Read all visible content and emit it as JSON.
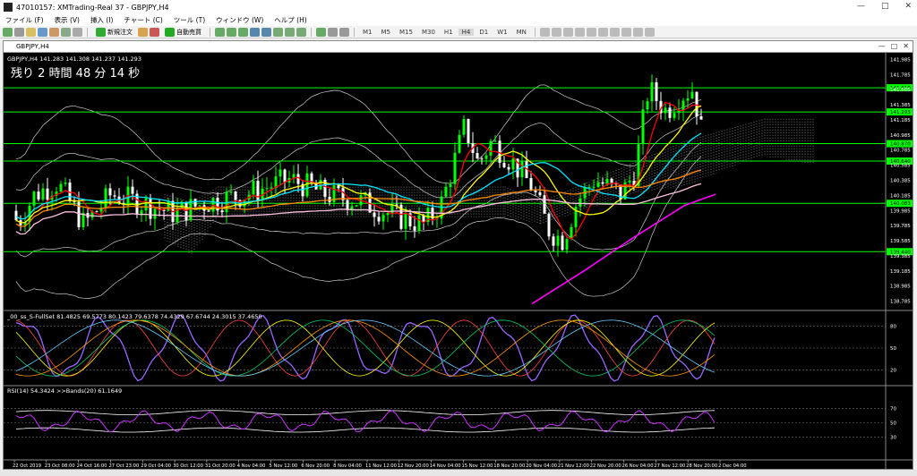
{
  "window": {
    "title": "47010157: XMTrading-Real 37 - GBPJPY,H4"
  },
  "menu": [
    "ファイル (F)",
    "表示 (V)",
    "挿入 (I)",
    "チャート (C)",
    "ツール (T)",
    "ウィンドウ (W)",
    "ヘルプ (H)"
  ],
  "toolbar": {
    "new_order": "新規注文",
    "auto_trade": "自動売買",
    "timeframes": [
      "M1",
      "M5",
      "M15",
      "M30",
      "H1",
      "H4",
      "D1",
      "W1",
      "MN"
    ],
    "active_timeframe": "H4"
  },
  "chart_window": {
    "title": "GBPJPY,H4"
  },
  "main_chart": {
    "info": "GBPJPY,H4  141.283 141.308 141.237 141.293",
    "countdown": "残り 2 時間 48 分 14 秒",
    "price_labels": [
      "141.985",
      "141.785",
      "141.585",
      "141.385",
      "141.185",
      "140.985",
      "140.785",
      "140.585",
      "140.385",
      "140.185",
      "139.985",
      "139.785",
      "139.585",
      "139.385",
      "139.185",
      "138.985",
      "138.785"
    ],
    "hlines": [
      {
        "price": 141.61,
        "label": "141.610"
      },
      {
        "price": 141.29,
        "label": "141.293"
      },
      {
        "price": 140.87,
        "label": "140.870"
      },
      {
        "price": 140.64,
        "label": "140.640"
      },
      {
        "price": 140.08,
        "label": "140.083"
      },
      {
        "price": 139.44,
        "label": "139.440"
      }
    ]
  },
  "indicator1": {
    "info": "_00_ss_S-FullSet 81.4825 69.5773 80.1423 79.6378 74.4329 67.6744 24.3015 37.4650",
    "levels": [
      "80",
      "50",
      "20"
    ]
  },
  "indicator2": {
    "info": "RSI(14) 54.3424  >>Bands(20) 61.1649",
    "levels": [
      "70",
      "50",
      "30"
    ]
  },
  "time_axis": [
    "22 Oct 2019",
    "23 Oct 08:00",
    "24 Oct 16:00",
    "27 Oct 23:00",
    "29 Oct 04:00",
    "30 Oct 12:00",
    "31 Oct 20:00",
    "4 Nov 04:00",
    "5 Nov 12:00",
    "6 Nov 20:00",
    "8 Nov 04:00",
    "11 Nov 12:00",
    "12 Nov 20:00",
    "14 Nov 04:00",
    "15 Nov 12:00",
    "18 Nov 20:00",
    "20 Nov 04:00",
    "21 Nov 12:00",
    "22 Nov 20:00",
    "26 Nov 04:00",
    "27 Nov 12:00",
    "28 Nov 20:00",
    "2 Dec 04:00"
  ],
  "colors": {
    "background": "#000000",
    "bull": "#00ff00",
    "bear": "#ffffff",
    "hline": "#00ff00",
    "ma_red": "#ff0000",
    "ma_yellow": "#ffff00",
    "ma_cyan": "#00e5ff",
    "ma_orange": "#ff8800",
    "ma_magenta": "#ff00ff",
    "ma_pink": "#ffc0e0",
    "band": "#cccccc"
  }
}
